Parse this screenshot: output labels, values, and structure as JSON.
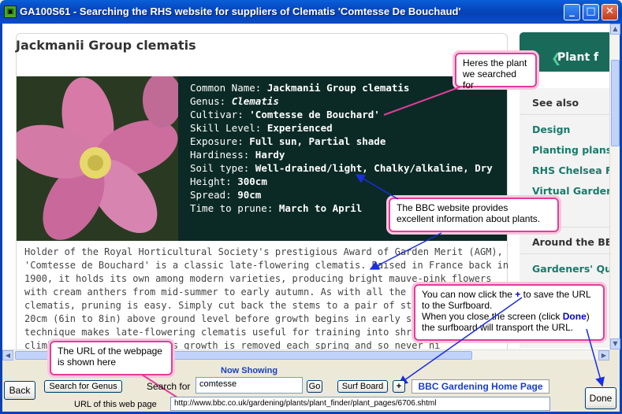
{
  "window": {
    "title": "GA100S61 - Searching the RHS website for suppliers of Clematis 'Comtesse De Bouchaud'",
    "minimize": "_",
    "maximize": "□",
    "close": "✕"
  },
  "page": {
    "title": "Jackmanii Group clematis",
    "facts": [
      {
        "label": "Common Name:",
        "value": "Jackmanii Group clematis"
      },
      {
        "label": "Genus:",
        "value": "Clematis"
      },
      {
        "label": "Cultivar:",
        "value": "'Comtesse de Bouchard'"
      },
      {
        "label": "Skill Level:",
        "value": "Experienced"
      },
      {
        "label": "Exposure:",
        "value": "Full sun, Partial shade"
      },
      {
        "label": "Hardiness:",
        "value": "Hardy"
      },
      {
        "label": "Soil type:",
        "value": "Well-drained/light, Chalky/alkaline, Dry"
      },
      {
        "label": "Height:",
        "value": "300cm"
      },
      {
        "label": "Spread:",
        "value": "90cm"
      },
      {
        "label": "Time to prune:",
        "value": "March to April"
      }
    ],
    "description_lines": [
      "Holder of the Royal Horticultural Society's prestigious Award of Garden Merit (AGM),",
      "'Comtesse de Bouchard' is a classic late-flowering clematis. Raised in France back in",
      "1900, it holds its own among modern varieties, producing bright mauve-pink flowers",
      "with cream anthers from mid-summer to early autumn. As with all the late-",
      "clematis, pruning is easy. Simply cut back the stems to a pair of strong bu",
      "20cm (6in to 8in) above ground level before growth begins in early spring.",
      "technique makes late-flowering clematis useful for training into shrubs, tre",
      "climb                     s growth is removed each spring and so never hi"
    ]
  },
  "rhs": {
    "header": "Plant f",
    "see_also": "See also",
    "links": [
      "Design",
      "Planting plans",
      "RHS Chelsea F",
      "Virtual Garden"
    ],
    "around": "Around the BBC",
    "gardeners": "Gardeners' Qu"
  },
  "callouts": {
    "plant": [
      "Heres the plant",
      "we searched for"
    ],
    "bbc": [
      "The BBC website provides",
      "excellent information about plants."
    ],
    "save_line1_a": "You can now click the ",
    "save_plus": "+",
    "save_line1_b": " to save the URL",
    "save_line2": "to the Surfboard.",
    "save_line3_a": "When you close the screen (click ",
    "save_done": "Done",
    "save_line3_b": ")",
    "save_line4": "the surfboard will transport the URL.",
    "url": [
      "The URL of the webpage",
      "is shown here"
    ]
  },
  "toolbar": {
    "back": "Back",
    "search_genus": "Search for Genus",
    "search_for_label": "Search for",
    "search_value": "comtesse",
    "go": "Go",
    "now_showing": "Now Showing",
    "surf_board": "Surf Board",
    "plus": "+",
    "home": "BBC Gardening Home Page",
    "url_label": "URL of this web page",
    "url_value": "http://www.bbc.co.uk/gardening/plants/plant_finder/plant_pages/6706.shtml",
    "done": "Done"
  }
}
